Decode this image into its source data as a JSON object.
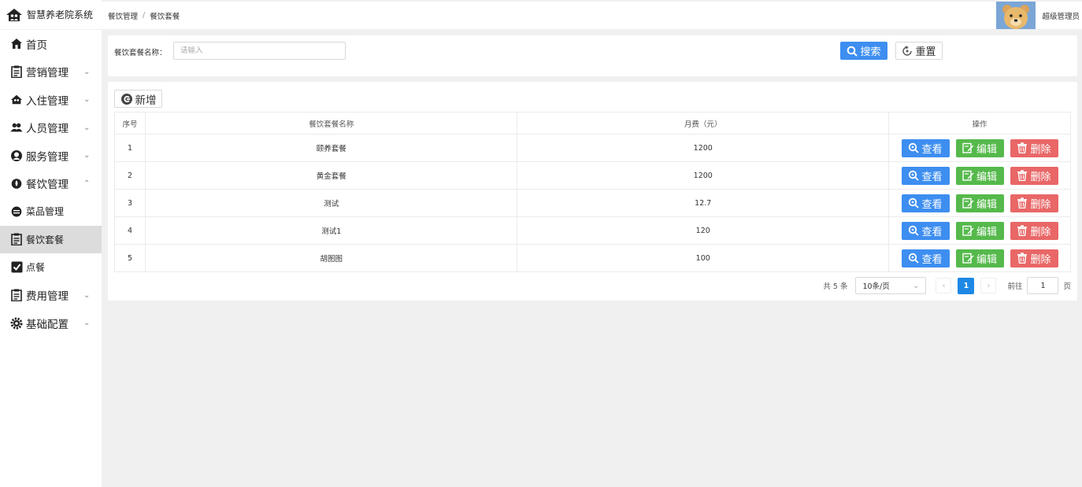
{
  "app": {
    "title": "智慧养老院系统"
  },
  "sidebar": {
    "items": [
      {
        "label": "首页",
        "icon": "home-icon",
        "chevron": ""
      },
      {
        "label": "营销管理",
        "icon": "clipboard-icon",
        "chevron": "⌄"
      },
      {
        "label": "入住管理",
        "icon": "house-people-icon",
        "chevron": "⌄"
      },
      {
        "label": "人员管理",
        "icon": "users-icon",
        "chevron": "⌄"
      },
      {
        "label": "服务管理",
        "icon": "service-icon",
        "chevron": "⌄"
      },
      {
        "label": "餐饮管理",
        "icon": "drop-icon",
        "chevron": "⌃"
      },
      {
        "label": "菜品管理",
        "icon": "dish-icon",
        "chevron": ""
      },
      {
        "label": "餐饮套餐",
        "icon": "clipboard-icon",
        "chevron": ""
      },
      {
        "label": "点餐",
        "icon": "checkbox-icon",
        "chevron": ""
      },
      {
        "label": "费用管理",
        "icon": "clipboard-icon",
        "chevron": "⌄"
      },
      {
        "label": "基础配置",
        "icon": "gear-icon",
        "chevron": "⌄"
      }
    ]
  },
  "breadcrumb": {
    "parent": "餐饮管理",
    "separator": "/",
    "current": "餐饮套餐"
  },
  "user": {
    "name": "超级管理员"
  },
  "search": {
    "label": "餐饮套餐名称：",
    "placeholder": "请输入",
    "value": "",
    "search_label": "搜索",
    "reset_label": "重置"
  },
  "toolbar": {
    "add_label": "新增"
  },
  "table": {
    "headers": [
      "序号",
      "餐饮套餐名称",
      "月费（元）",
      "操作"
    ],
    "rows": [
      {
        "idx": "1",
        "name": "颐养套餐",
        "fee": "1200"
      },
      {
        "idx": "2",
        "name": "黄金套餐",
        "fee": "1200"
      },
      {
        "idx": "3",
        "name": "测试",
        "fee": "12.7"
      },
      {
        "idx": "4",
        "name": "测试1",
        "fee": "120"
      },
      {
        "idx": "5",
        "name": "胡图图",
        "fee": "100"
      }
    ],
    "actions": {
      "view": "查看",
      "edit": "编辑",
      "delete": "删除"
    }
  },
  "pagination": {
    "total": "共 5 条",
    "page_size": "10条/页",
    "current_page": "1",
    "goto_label": "前往",
    "goto_value": "1",
    "page_unit": "页"
  },
  "colors": {
    "primary": "#3d8ef0",
    "success": "#55b94b",
    "danger": "#e96767",
    "active_menu": "#dcdcdc",
    "background": "#f0f0f0"
  }
}
